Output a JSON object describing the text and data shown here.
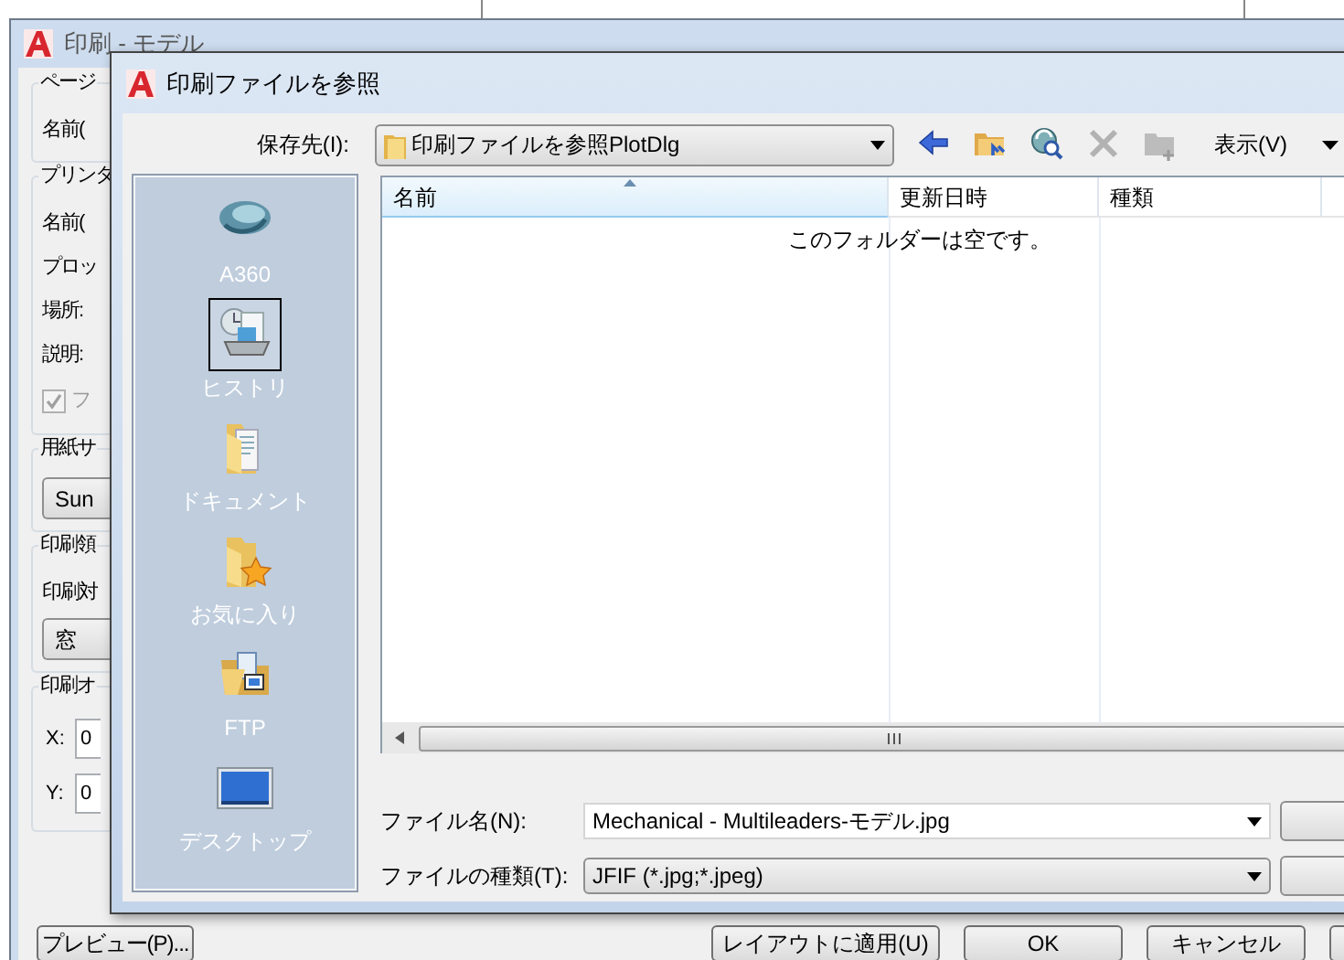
{
  "back_window": {
    "title": "印刷 - モデル",
    "groups": [
      {
        "title": "ページ",
        "items": [
          {
            "kind": "label",
            "text": "名前("
          }
        ]
      },
      {
        "title": "プリンタ",
        "items": [
          {
            "kind": "label",
            "text": "名前("
          },
          {
            "kind": "label",
            "text": "プロッ"
          },
          {
            "kind": "label",
            "text": "場所:"
          },
          {
            "kind": "label",
            "text": "説明:"
          },
          {
            "kind": "checkbox",
            "text": "フ",
            "checked": true,
            "disabled": true
          }
        ]
      },
      {
        "title": "用紙サ",
        "items": [
          {
            "kind": "dropdown",
            "text": "Sun"
          }
        ]
      },
      {
        "title": "印刷領",
        "items": [
          {
            "kind": "label",
            "text": "印刷対"
          },
          {
            "kind": "dropdown",
            "text": "窓"
          }
        ]
      },
      {
        "title": "印刷オ",
        "items": [
          {
            "kind": "field",
            "text": "X:",
            "value": "0"
          },
          {
            "kind": "field",
            "text": "Y:",
            "value": "0"
          }
        ]
      }
    ],
    "buttons_left": [
      "プレビュー(P)..."
    ],
    "buttons_right": [
      "レイアウトに適用(U)",
      "OK",
      "キャンセル"
    ]
  },
  "dialog": {
    "title": "印刷ファイルを参照",
    "save_in": {
      "label": "保存先(I):",
      "value": "印刷ファイルを参照PlotDlg"
    },
    "toolbar": {
      "buttons": [
        {
          "disabled": false
        },
        {
          "disabled": false
        },
        {
          "disabled": false
        },
        {
          "disabled": true
        },
        {
          "disabled": true
        }
      ],
      "view_menu": "表示(V)"
    },
    "places": [
      {
        "label": "A360",
        "selected": false
      },
      {
        "label": "ヒストリ",
        "selected": true
      },
      {
        "label": "ドキュメント",
        "selected": false
      },
      {
        "label": "お気に入り",
        "selected": false
      },
      {
        "label": "FTP",
        "selected": false
      },
      {
        "label": "デスクトップ",
        "selected": false
      }
    ],
    "columns": [
      {
        "label": "名前",
        "sorted": true
      },
      {
        "label": "更新日時",
        "sorted": false
      },
      {
        "label": "種類",
        "sorted": false
      }
    ],
    "empty_message": "このフォルダーは空です。",
    "file_name": {
      "label": "ファイル名(N):",
      "value": "Mechanical - Multileaders-モデル.jpg"
    },
    "file_type": {
      "label": "ファイルの種類(T):",
      "value": "JFIF (*.jpg;*.jpeg)"
    }
  }
}
